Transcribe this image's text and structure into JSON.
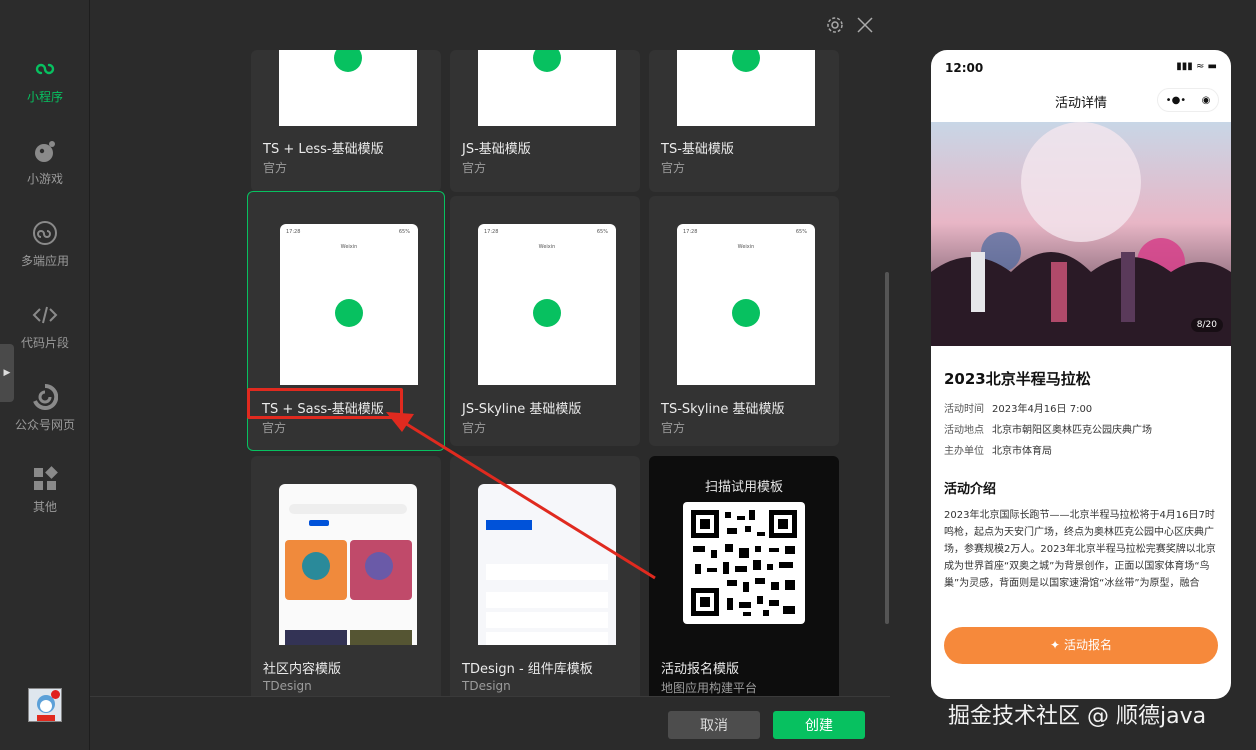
{
  "sidebar": {
    "items": [
      {
        "label": "小程序",
        "icon": "miniprogram-icon",
        "active": true
      },
      {
        "label": "小游戏",
        "icon": "minigame-icon",
        "active": false
      },
      {
        "label": "多端应用",
        "icon": "multiplatform-icon",
        "active": false
      },
      {
        "label": "代码片段",
        "icon": "code-snippet-icon",
        "active": false
      },
      {
        "label": "公众号网页",
        "icon": "official-account-icon",
        "active": false
      },
      {
        "label": "其他",
        "icon": "grid-icon",
        "active": false
      }
    ]
  },
  "templates": {
    "row1": [
      {
        "title": "TS + Less-基础模版",
        "source": "官方"
      },
      {
        "title": "JS-基础模版",
        "source": "官方"
      },
      {
        "title": "TS-基础模版",
        "source": "官方"
      }
    ],
    "row2": [
      {
        "title": "TS + Sass-基础模版",
        "source": "官方",
        "selected": true
      },
      {
        "title": "JS-Skyline 基础模版",
        "source": "官方"
      },
      {
        "title": "TS-Skyline 基础模版",
        "source": "官方"
      }
    ],
    "row3": [
      {
        "title": "社区内容模版",
        "source": "TDesign"
      },
      {
        "title": "TDesign - 组件库模板",
        "source": "TDesign"
      },
      {
        "title": "活动报名模版",
        "source": "地图应用构建平台"
      }
    ],
    "preview_time": "17:28",
    "preview_title": "Weixin",
    "preview_battery": "65%",
    "qr_label": "扫描试用模板"
  },
  "footer": {
    "cancel": "取消",
    "create": "创建"
  },
  "phone": {
    "time": "12:00",
    "nav_title": "活动详情",
    "image_counter": "8/20",
    "event_title": "2023北京半程马拉松",
    "info": [
      {
        "key": "活动时间",
        "value": "2023年4月16日 7:00"
      },
      {
        "key": "活动地点",
        "value": "北京市朝阳区奥林匹克公园庆典广场"
      },
      {
        "key": "主办单位",
        "value": "北京市体育局"
      }
    ],
    "section_title": "活动介绍",
    "description": "2023年北京国际长跑节——北京半程马拉松将于4月16日7时鸣枪，起点为天安门广场，终点为奥林匹克公园中心区庆典广场，参赛规模2万人。2023年北京半程马拉松完赛奖牌以北京成为世界首座“双奥之城”为背景创作，正面以国家体育场“鸟巢”为灵感，背面则是以国家速滑馆“冰丝带”为原型，融合",
    "signup": "活动报名"
  },
  "watermark": "掘金技术社区 @ 顺德java",
  "colors": {
    "accent": "#07c160",
    "annotation": "#e02a1f",
    "signup": "#f6893b"
  }
}
